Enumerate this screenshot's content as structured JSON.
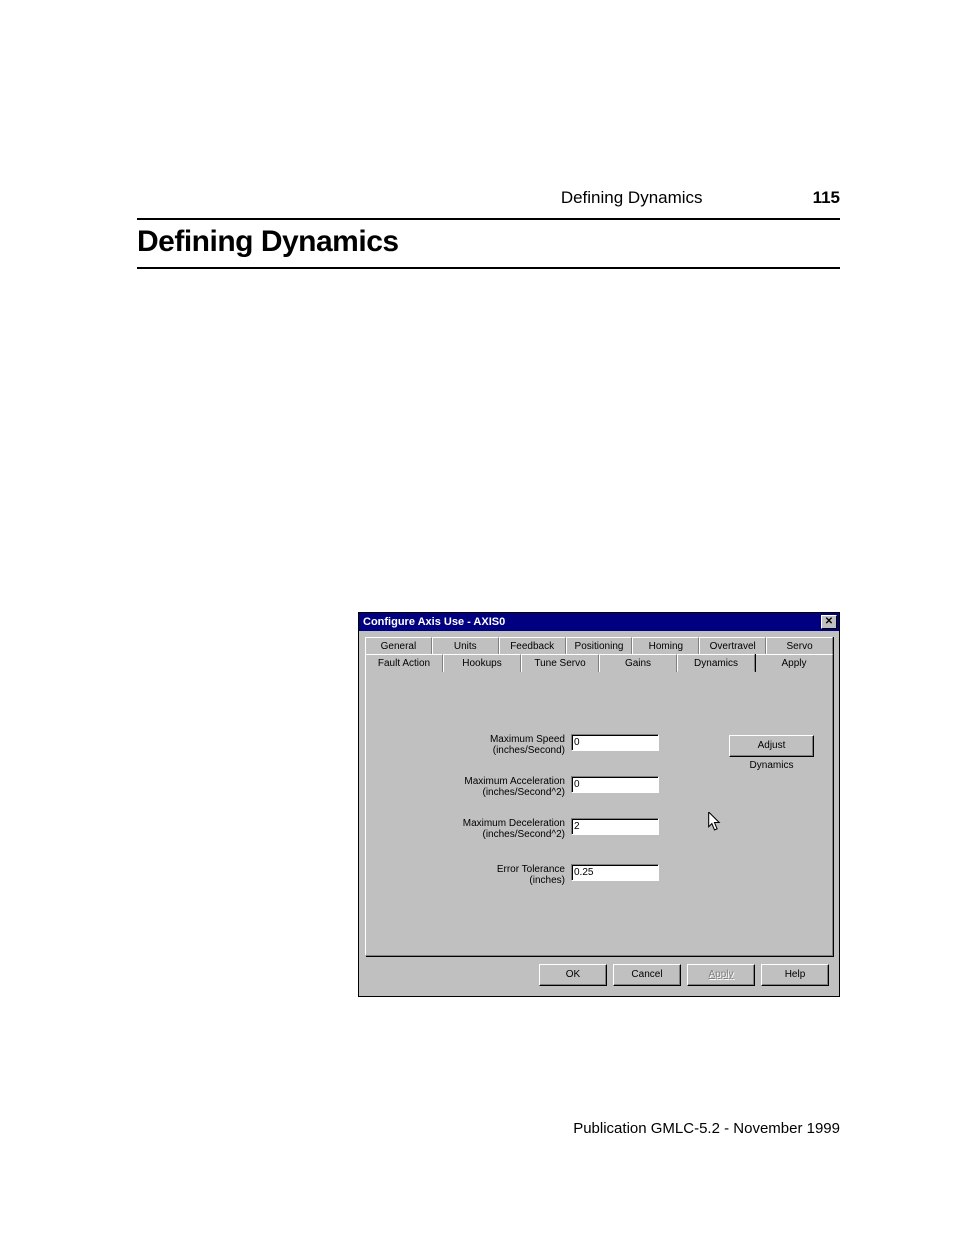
{
  "header": {
    "running_head": "Defining Dynamics",
    "page_number": "115"
  },
  "title": "Defining Dynamics",
  "dialog": {
    "title": "Configure Axis Use - AXIS0",
    "tabs_row1": [
      "General",
      "Units",
      "Feedback",
      "Positioning",
      "Homing",
      "Overtravel",
      "Servo"
    ],
    "tabs_row2": [
      "Fault Action",
      "Hookups",
      "Tune Servo",
      "Gains",
      "Dynamics",
      "Apply"
    ],
    "active_tab": "Dynamics",
    "fields": {
      "max_speed": {
        "label": "Maximum Speed",
        "unit": "(inches/Second)",
        "value": "0"
      },
      "max_accel": {
        "label": "Maximum Acceleration",
        "unit": "(inches/Second^2)",
        "value": "0"
      },
      "max_decel": {
        "label": "Maximum Deceleration",
        "unit": "(inches/Second^2)",
        "value": "2"
      },
      "err_tol": {
        "label": "Error Tolerance",
        "unit": "(inches)",
        "value": "0.25"
      }
    },
    "adjust_button": "Adjust Dynamics",
    "buttons": {
      "ok": "OK",
      "cancel": "Cancel",
      "apply": "Apply",
      "help": "Help"
    }
  },
  "footer": "Publication GMLC-5.2 - November 1999"
}
